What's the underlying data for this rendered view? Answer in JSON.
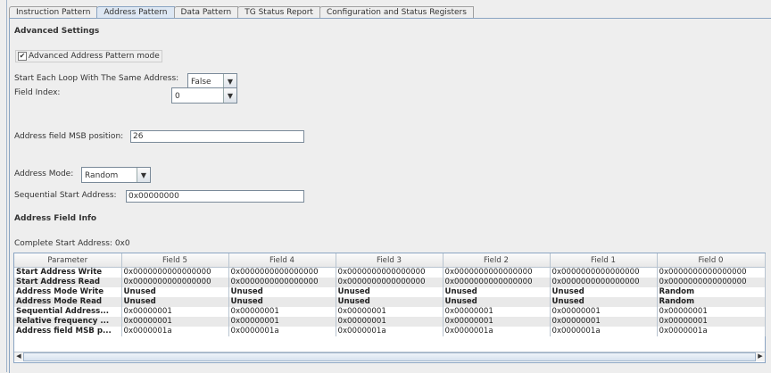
{
  "tabs": [
    "Instruction Pattern",
    "Address Pattern",
    "Data Pattern",
    "TG Status Report",
    "Configuration and Status Registers"
  ],
  "active_tab": "Address Pattern",
  "advanced": {
    "title": "Advanced Settings",
    "checkbox_label": "Advanced Address Pattern mode",
    "checked": true,
    "same_address_label": "Start Each Loop With The Same Address:",
    "same_address_value": "False",
    "field_index_label": "Field Index:",
    "field_index_value": "0",
    "msb_label": "Address field MSB position:",
    "msb_value": "26",
    "mode_label": "Address Mode:",
    "mode_value": "Random",
    "seq_label": "Sequential Start Address:",
    "seq_value": "0x00000000"
  },
  "info": {
    "title": "Address Field Info",
    "complete_label": "Complete Start Address: 0x0"
  },
  "table": {
    "headers": [
      "Parameter",
      "Field 5",
      "Field 4",
      "Field 3",
      "Field 2",
      "Field 1",
      "Field 0"
    ],
    "rows": [
      [
        "Start Address Write",
        "0x0000000000000000",
        "0x0000000000000000",
        "0x0000000000000000",
        "0x0000000000000000",
        "0x0000000000000000",
        "0x0000000000000000"
      ],
      [
        "Start Address Read",
        "0x0000000000000000",
        "0x0000000000000000",
        "0x0000000000000000",
        "0x0000000000000000",
        "0x0000000000000000",
        "0x0000000000000000"
      ],
      [
        "Address Mode Write",
        "Unused",
        "Unused",
        "Unused",
        "Unused",
        "Unused",
        "Random"
      ],
      [
        "Address Mode Read",
        "Unused",
        "Unused",
        "Unused",
        "Unused",
        "Unused",
        "Random"
      ],
      [
        "Sequential Address...",
        "0x00000001",
        "0x00000001",
        "0x00000001",
        "0x00000001",
        "0x00000001",
        "0x00000001"
      ],
      [
        "Relative frequency ...",
        "0x00000001",
        "0x00000001",
        "0x00000001",
        "0x00000001",
        "0x00000001",
        "0x00000001"
      ],
      [
        "Address field MSB p...",
        "0x0000001a",
        "0x0000001a",
        "0x0000001a",
        "0x0000001a",
        "0x0000001a",
        "0x0000001a"
      ]
    ]
  }
}
